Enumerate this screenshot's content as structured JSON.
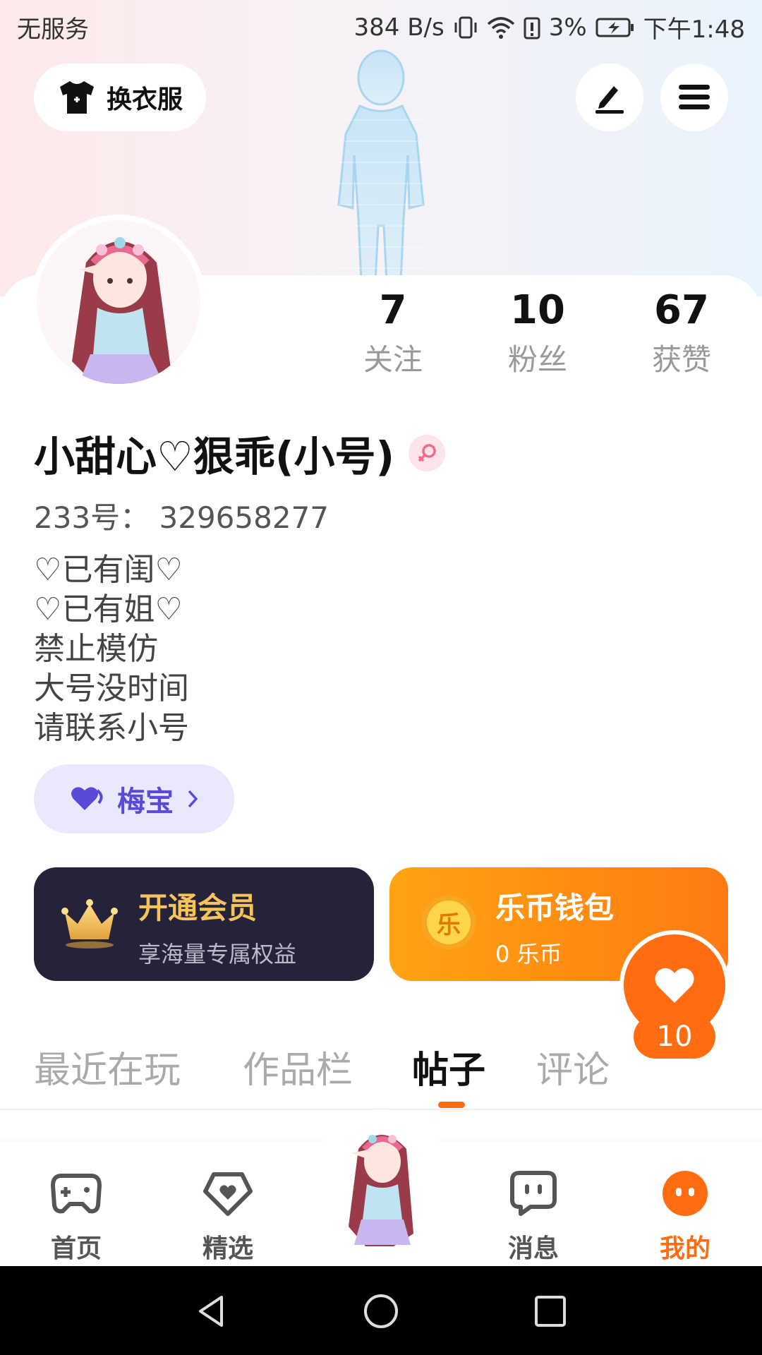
{
  "status_bar": {
    "carrier": "无服务",
    "speed": "384 B/s",
    "battery": "3%",
    "time": "下午1:48"
  },
  "header": {
    "outfit_button": "换衣服"
  },
  "stats": [
    {
      "value": "7",
      "label": "关注"
    },
    {
      "value": "10",
      "label": "粉丝"
    },
    {
      "value": "67",
      "label": "获赞"
    }
  ],
  "profile": {
    "nickname": "小甜心♡狠乖(小号)",
    "user_id": "233号： 329658277",
    "bio": [
      "♡已有闺♡",
      "♡已有姐♡",
      "禁止模仿",
      "大号没时间",
      "请联系小号"
    ],
    "tag": "梅宝"
  },
  "cards": {
    "vip_title": "开通会员",
    "vip_sub": "享海量专属权益",
    "wallet_title": "乐币钱包",
    "wallet_sub": "0 乐币",
    "coin_glyph": "乐"
  },
  "like_float": {
    "count": "10"
  },
  "tabs": [
    "最近在玩",
    "作品栏",
    "帖子",
    "评论"
  ],
  "bottom_nav": [
    "首页",
    "精选",
    "消息",
    "我的"
  ],
  "colors": {
    "accent": "#ff6c12",
    "vip_bg": "#25233a",
    "tag_bg": "#eae8fc"
  }
}
